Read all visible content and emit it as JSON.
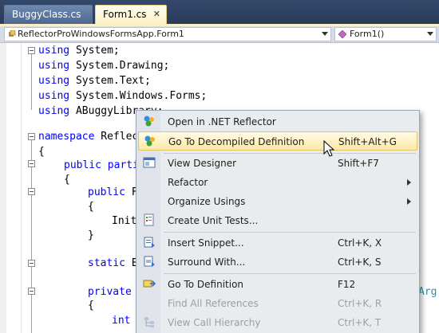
{
  "tabs": [
    {
      "label": "BuggyClass.cs",
      "active": false
    },
    {
      "label": "Form1.cs",
      "active": true,
      "close": "✕"
    }
  ],
  "navbar": {
    "type_selector": "ReflectorProWindowsFormsApp.Form1",
    "member_selector": "Form1()"
  },
  "code": {
    "lines": [
      "using System;",
      "using System.Drawing;",
      "using System.Text;",
      "using System.Windows.Forms;",
      "using ABuggyLibrary;",
      "namespace Reflec",
      "{",
      "public parti",
      "{",
      "public F",
      "{",
      "Init",
      "}",
      "static E",
      "private",
      "{",
      "int",
      "Arg"
    ]
  },
  "menu": {
    "items": [
      {
        "label": "Open in .NET Reflector",
        "shortcut": "",
        "icon": "reflector-icon"
      },
      {
        "label": "Go To Decompiled Definition",
        "shortcut": "Shift+Alt+G",
        "icon": "reflector-icon",
        "highlighted": true
      },
      {
        "label": "View Designer",
        "shortcut": "Shift+F7",
        "icon": "designer-icon"
      },
      {
        "label": "Refactor",
        "shortcut": "",
        "submenu": true
      },
      {
        "label": "Organize Usings",
        "shortcut": "",
        "submenu": true
      },
      {
        "label": "Create Unit Tests...",
        "shortcut": "",
        "icon": "unit-test-icon"
      },
      {
        "label": "Insert Snippet...",
        "shortcut": "Ctrl+K, X",
        "icon": "snippet-icon"
      },
      {
        "label": "Surround With...",
        "shortcut": "Ctrl+K, S",
        "icon": "surround-icon"
      },
      {
        "label": "Go To Definition",
        "shortcut": "F12",
        "icon": "definition-icon"
      },
      {
        "label": "Find All References",
        "shortcut": "Ctrl+K, R",
        "disabled": true
      },
      {
        "label": "View Call Hierarchy",
        "shortcut": "Ctrl+K, T",
        "disabled": true,
        "icon": "hierarchy-icon"
      }
    ]
  },
  "colors": {
    "keyword": "#0000ff",
    "type": "#2b91af",
    "highlight": "#fbe9a7",
    "chrome": "#2b3c59"
  }
}
